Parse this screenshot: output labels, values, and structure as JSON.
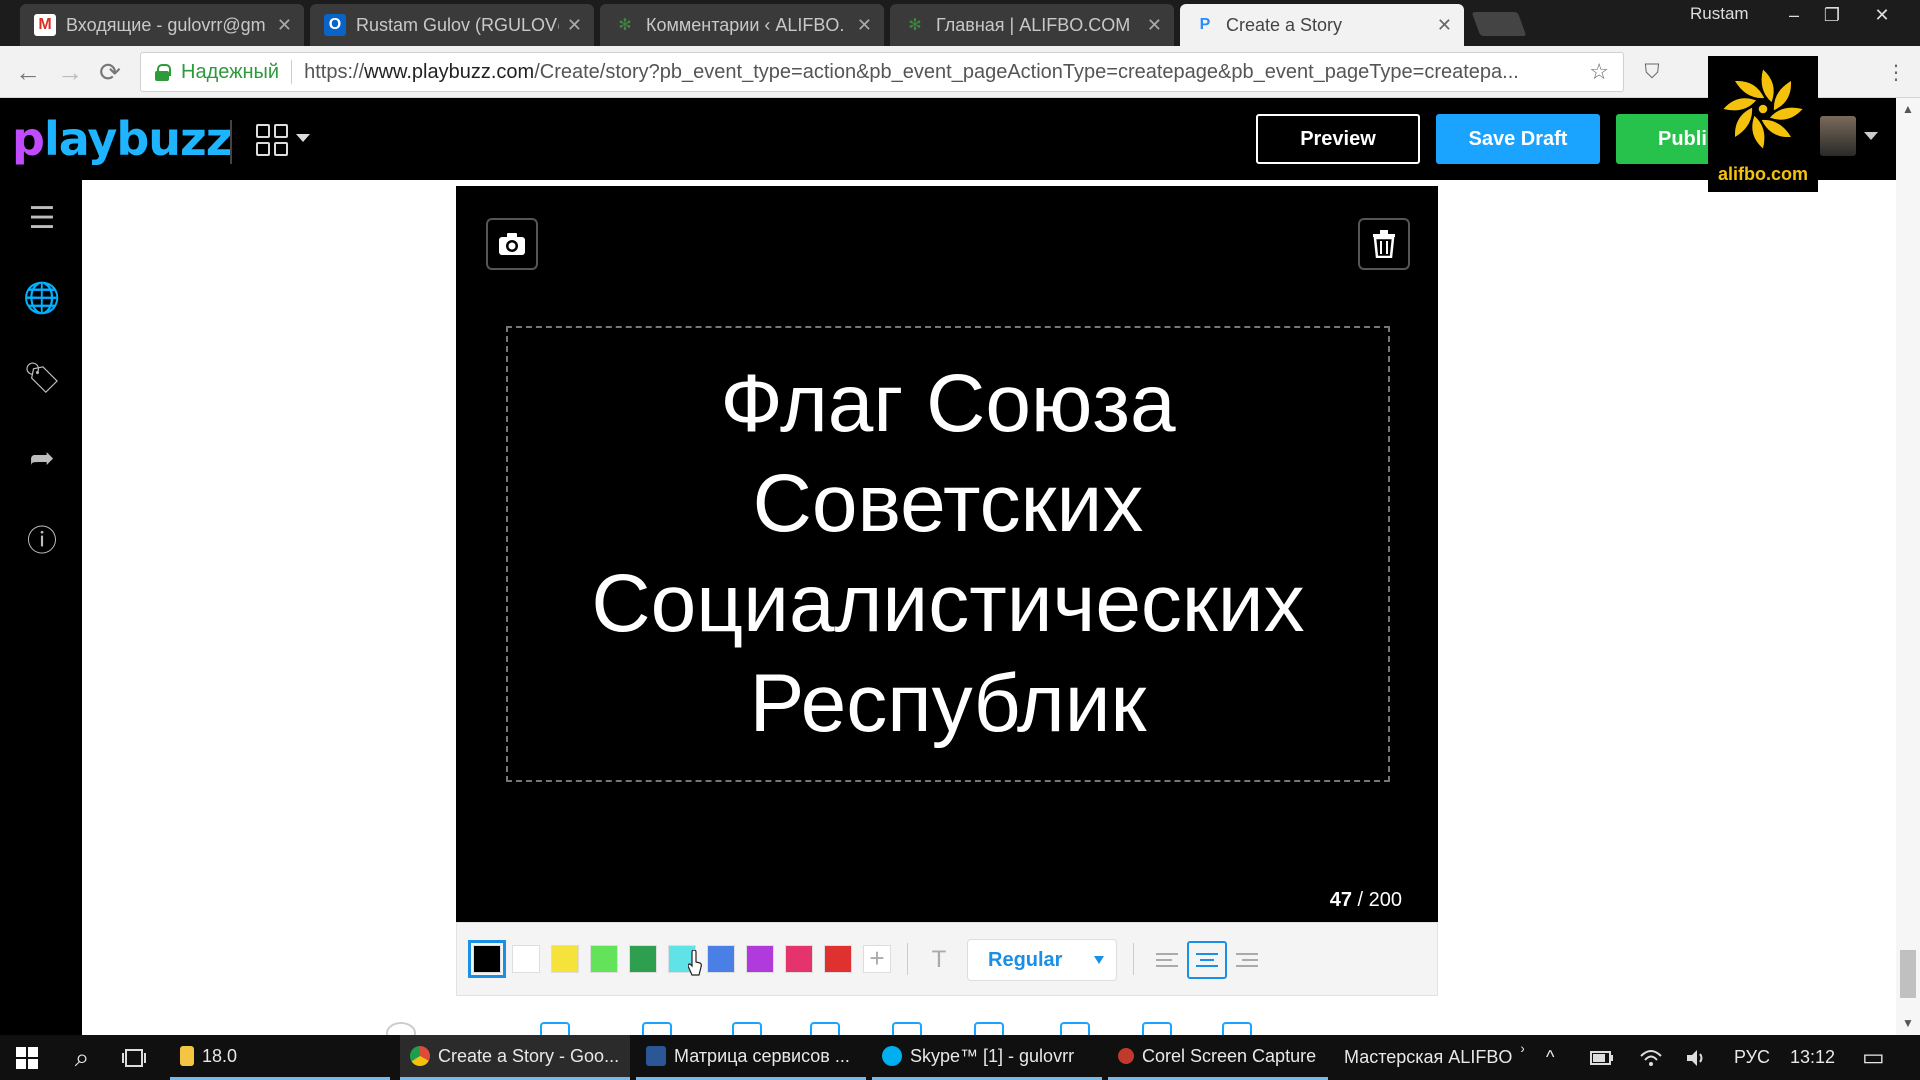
{
  "browser": {
    "tabs": [
      {
        "title": "Входящие - gulovrr@gm",
        "icon": "gmail-icon",
        "color": "#d93025",
        "glyph": "M"
      },
      {
        "title": "Rustam Gulov (RGULOV@",
        "icon": "outlook-icon",
        "color": "#0a64c8",
        "glyph": "O"
      },
      {
        "title": "Комментарии ‹ ALIFBO.",
        "icon": "gear-icon",
        "color": "#3b8a3e",
        "glyph": "✻"
      },
      {
        "title": "Главная | ALIFBO.COM",
        "icon": "gear-icon",
        "color": "#3b8a3e",
        "glyph": "✻"
      },
      {
        "title": "Create a Story",
        "icon": "playbuzz-icon",
        "color": "#2a8cff",
        "glyph": "P"
      }
    ],
    "close_glyph": "✕",
    "profile_name": "Rustam",
    "window_controls": {
      "minimize": "–",
      "restore": "❐",
      "close": "✕"
    },
    "nav": {
      "back": "←",
      "forward": "→",
      "reload": "⟳"
    },
    "address": {
      "secure_label": "Надежный",
      "url_scheme": "https://",
      "url_host": "www.playbuzz.com",
      "url_path": "/Create/story?pb_event_type=action&pb_event_pageActionType=createpage&pb_event_pageType=createpa..."
    },
    "star_glyph": "☆",
    "menu_glyph": "⋮",
    "ext_glyph": "⛉"
  },
  "app": {
    "logo_p": "p",
    "logo_rest": "laybuzz",
    "buttons": {
      "preview": "Preview",
      "save_draft": "Save Draft",
      "publish": "Publi"
    },
    "watermark": "alifbo.com"
  },
  "sidebar": {
    "items": [
      {
        "name": "menu-icon",
        "glyph": "☰"
      },
      {
        "name": "globe-settings-icon",
        "glyph": "🌐"
      },
      {
        "name": "tag-icon",
        "glyph": "🏷"
      },
      {
        "name": "share-icon",
        "glyph": "➦"
      },
      {
        "name": "info-icon",
        "glyph": "ⓘ"
      }
    ]
  },
  "editor": {
    "camera_glyph": "📷",
    "trash_glyph": "🗑",
    "headline": "Флаг Союза Советских Социалистических Республик",
    "char_count": "47",
    "char_limit": "/ 200",
    "swatches": [
      "#000000",
      "#ffffff",
      "#f5e33b",
      "#63e35a",
      "#2e9e4f",
      "#5fe3e6",
      "#4a7fe6",
      "#b03adb",
      "#e5336e",
      "#e03131"
    ],
    "selected_swatch": "#000000",
    "add_color_glyph": "+",
    "text_size_glyph": "T",
    "font_style": "Regular",
    "alignment": "center"
  },
  "taskbar": {
    "search_glyph": "⌕",
    "items": [
      {
        "label": "18.0",
        "icon_color": "#f4c542"
      },
      {
        "label": "Create a Story - Goo...",
        "icon_color": "#dd4b39"
      },
      {
        "label": "Матрица сервисов ...",
        "icon_color": "#2b5797"
      },
      {
        "label": "Skype™ [1] - gulovrr",
        "icon_color": "#00aff0"
      },
      {
        "label": "Corel Screen Capture",
        "icon_color": "#c0392b"
      }
    ],
    "toolbar_label": "Мастерская ALIFBO",
    "more_glyph": "»",
    "tray_up_glyph": "^",
    "language": "РУС",
    "time": "13:12",
    "notification_glyph": "▭"
  }
}
